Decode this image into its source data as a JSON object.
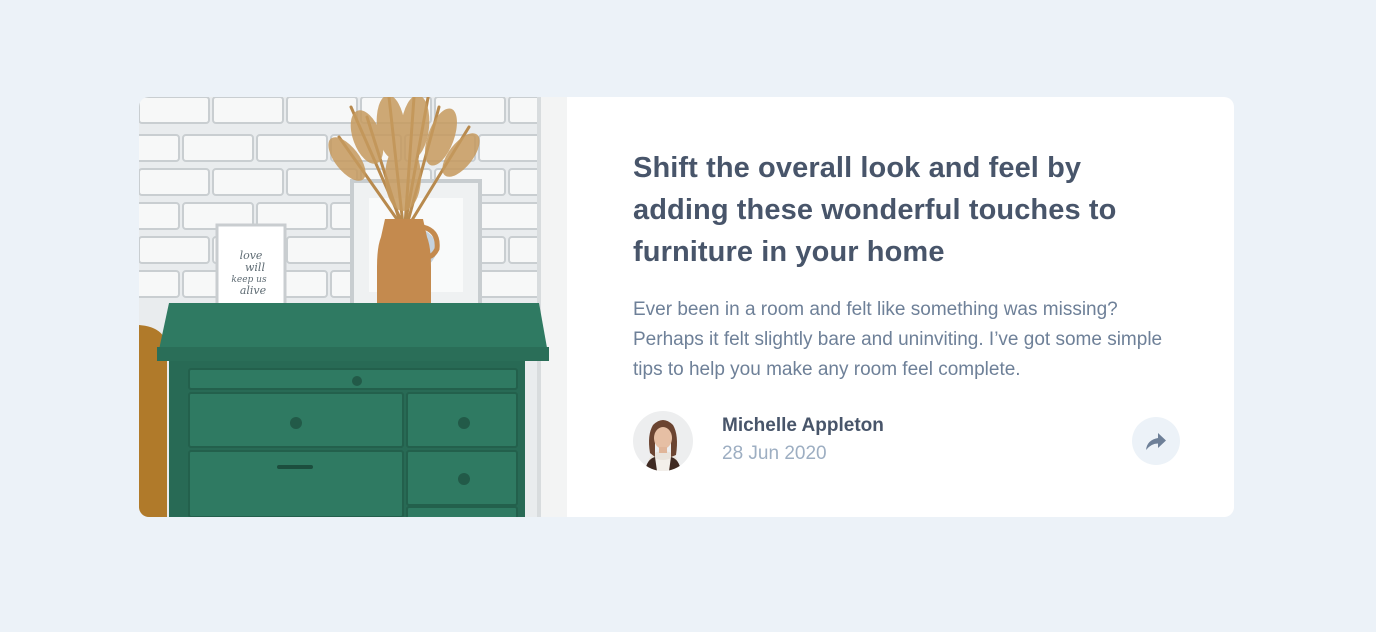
{
  "article": {
    "title": "Shift the overall look and feel by adding these wonderful touches to furniture in your home",
    "description": "Ever been in a room and felt like something was missing? Perhaps it felt slightly bare and uninviting. I’ve got some simple tips to help you make any room feel complete.",
    "photo_frame_text": "love will keep us alive"
  },
  "author": {
    "name": "Michelle Appleton",
    "date": "28 Jun 2020"
  },
  "share": {
    "icon": "share-icon"
  },
  "colors": {
    "background": "#ECF2F8",
    "card": "#FFFFFF",
    "heading": "#48556A",
    "body": "#6E8098",
    "muted": "#9DAEC2",
    "drawer_green": "#2F7A62"
  }
}
